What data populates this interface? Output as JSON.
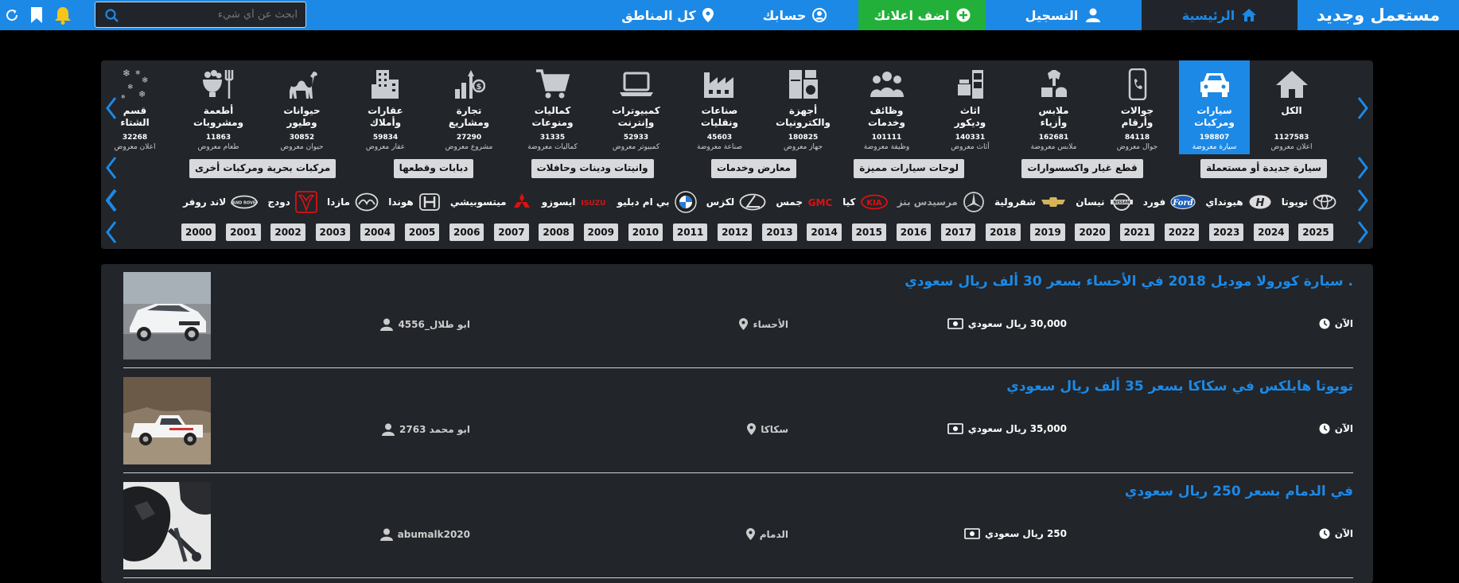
{
  "topbar": {
    "logo": "مستعمل وجديد",
    "home": "الرئيسية",
    "register": "التسجيل",
    "add_ad": "اضف اعلانك",
    "account": "حسابك",
    "regions": "كل المناطق",
    "search_placeholder": "ابحث عن أي شيء"
  },
  "categories": [
    {
      "name1": "الكل",
      "name2": "",
      "count": "1127583",
      "unit": "اعلان معروض",
      "icon": "house-icon"
    },
    {
      "name1": "سيارات",
      "name2": "ومركبات",
      "count": "198807",
      "unit": "سيارة معروضة",
      "icon": "car-icon"
    },
    {
      "name1": "جوالات",
      "name2": "وأرقام",
      "count": "84118",
      "unit": "جوال معروض",
      "icon": "phone-icon"
    },
    {
      "name1": "ملابس",
      "name2": "وأزياء",
      "count": "162681",
      "unit": "ملابس معروضة",
      "icon": "clothes-icon"
    },
    {
      "name1": "اثاث",
      "name2": "وديكور",
      "count": "140331",
      "unit": "أثاث معروض",
      "icon": "furniture-icon"
    },
    {
      "name1": "وظائف",
      "name2": "وخدمات",
      "count": "101111",
      "unit": "وظيفة معروضة",
      "icon": "people-icon"
    },
    {
      "name1": "أجهزة",
      "name2": "والكترونيات",
      "count": "180825",
      "unit": "جهاز معروض",
      "icon": "appliance-icon"
    },
    {
      "name1": "صناعات",
      "name2": "ونقليات",
      "count": "45603",
      "unit": "صناعة معروضة",
      "icon": "factory-icon"
    },
    {
      "name1": "كمبيوترات",
      "name2": "وإنترنت",
      "count": "52933",
      "unit": "كمبيوتر معروض",
      "icon": "laptop-icon"
    },
    {
      "name1": "كماليات",
      "name2": "ومنوعات",
      "count": "31335",
      "unit": "كماليات معروضة",
      "icon": "cart-icon"
    },
    {
      "name1": "تجارة",
      "name2": "ومشاريع",
      "count": "27290",
      "unit": "مشروع معروض",
      "icon": "growth-icon"
    },
    {
      "name1": "عقارات",
      "name2": "وأملاك",
      "count": "59834",
      "unit": "عقار معروض",
      "icon": "building-icon"
    },
    {
      "name1": "حيوانات",
      "name2": "وطيور",
      "count": "30852",
      "unit": "حيوان معروض",
      "icon": "camel-icon"
    },
    {
      "name1": "أطعمة",
      "name2": "ومشروبات",
      "count": "11863",
      "unit": "طعام معروض",
      "icon": "food-icon"
    },
    {
      "name1": "قسم",
      "name2": "الشتاء",
      "count": "32268",
      "unit": "اعلان معروض",
      "icon": "snow-icon"
    }
  ],
  "subcategories": [
    "سيارة جديدة أو مستعملة",
    "قطع غيار واكسسوارات",
    "لوحات سيارات مميزة",
    "معارض وخدمات",
    "وانيتات ودينات وحافلات",
    "دبابات وقطعها",
    "مركبات بحرية ومركبات أخرى"
  ],
  "brands": [
    {
      "name": "تويوتا",
      "icon": "toyota-logo-icon"
    },
    {
      "name": "هيونداي",
      "icon": "hyundai-logo-icon"
    },
    {
      "name": "فورد",
      "icon": "ford-logo-icon"
    },
    {
      "name": "نيسان",
      "icon": "nissan-logo-icon"
    },
    {
      "name": "شفرولية",
      "icon": "chevrolet-logo-icon"
    },
    {
      "name": "مرسيدس بنز",
      "icon": "mercedes-logo-icon"
    },
    {
      "name": "كيا",
      "icon": "kia-logo-icon"
    },
    {
      "name": "جمس",
      "icon": "gmc-logo-icon"
    },
    {
      "name": "لكزس",
      "icon": "lexus-logo-icon"
    },
    {
      "name": "بي ام دبليو",
      "icon": "bmw-logo-icon"
    },
    {
      "name": "ايسوزو",
      "icon": "isuzu-logo-icon",
      "logo_text": "ISUZU"
    },
    {
      "name": "ميتسوبيشي",
      "icon": "mitsubishi-logo-icon"
    },
    {
      "name": "هوندا",
      "icon": "honda-logo-icon"
    },
    {
      "name": "مازدا",
      "icon": "mazda-logo-icon"
    },
    {
      "name": "دودج",
      "icon": "dodge-logo-icon"
    },
    {
      "name": "لاند روفر",
      "icon": "landrover-logo-icon"
    }
  ],
  "years": [
    "2025",
    "2024",
    "2023",
    "2022",
    "2021",
    "2020",
    "2019",
    "2018",
    "2017",
    "2016",
    "2015",
    "2014",
    "2013",
    "2012",
    "2011",
    "2010",
    "2009",
    "2008",
    "2007",
    "2006",
    "2005",
    "2004",
    "2003",
    "2002",
    "2001",
    "2000"
  ],
  "listings": [
    {
      "title": ". سيارة كورولا موديل 2018 في الأحساء بسعر 30 ألف ريال سعودي",
      "time": "الآن",
      "price": "30,000 ريال سعودي",
      "location": "الأحساء",
      "user": "ابو طلال_4556",
      "thumb": "white-sedan"
    },
    {
      "title": "تويوتا هايلكس في سكاكا بسعر 35 ألف ريال سعودي",
      "time": "الآن",
      "price": "35,000 ريال سعودي",
      "location": "سكاكا",
      "user": "ابو محمد 2763",
      "thumb": "white-pickup"
    },
    {
      "title": "في الدمام بسعر 250 ريال سعودي",
      "time": "الآن",
      "price": "250 ريال سعودي",
      "location": "الدمام",
      "user": "abumalk2020",
      "thumb": "car-parts"
    }
  ],
  "colors": {
    "accent": "#1c89e6",
    "green": "#22b03a",
    "panel": "#22252a"
  }
}
